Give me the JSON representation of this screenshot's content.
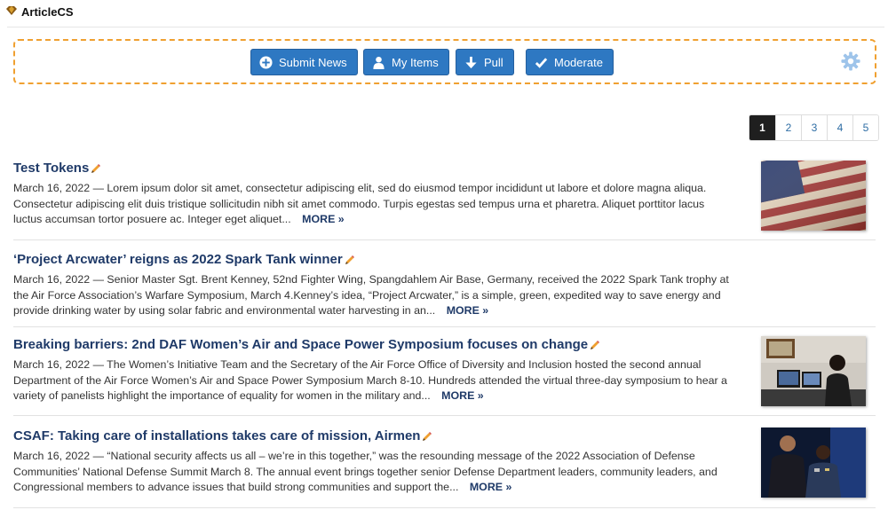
{
  "app": {
    "title": "ArticleCS"
  },
  "toolbar": {
    "submit_label": "Submit News",
    "myitems_label": "My Items",
    "pull_label": "Pull",
    "moderate_label": "Moderate",
    "icons": [
      "plus-circle-icon",
      "user-icon",
      "arrow-down-icon",
      "check-icon",
      "gear-icon"
    ],
    "button_color": "#2e78c2",
    "border_color": "#f0a030"
  },
  "pagination": {
    "pages": [
      "1",
      "2",
      "3",
      "4",
      "5"
    ],
    "active": "1"
  },
  "articles": [
    {
      "title": "Test Tokens",
      "date": "March 16, 2022",
      "summary": "Lorem ipsum dolor sit amet, consectetur adipiscing elit, sed do eiusmod tempor incididunt ut labore et dolore magna aliqua. Consectetur adipiscing elit duis tristique sollicitudin nibh sit amet commodo. Turpis egestas sed tempus urna et pharetra. Aliquet porttitor lacus luctus accumsan tortor posuere ac. Integer eget aliquet...",
      "more": "MORE »",
      "thumbnail": "american-flag-image"
    },
    {
      "title": "‘Project Arcwater’ reigns as 2022 Spark Tank winner",
      "date": "March 16, 2022",
      "summary": "Senior Master Sgt. Brent Kenney, 52nd Fighter Wing, Spangdahlem Air Base, Germany, received the 2022 Spark Tank trophy at the Air Force Association’s Warfare Symposium, March 4.Kenney’s idea, “Project Arcwater,” is a simple, green, expedited way to save energy and provide drinking water by using solar fabric and environmental water harvesting in an...",
      "more": "MORE »"
    },
    {
      "title": "Breaking barriers: 2nd DAF Women’s Air and Space Power Symposium focuses on change",
      "date": "March 16, 2022",
      "summary": "The Women’s Initiative Team and the Secretary of the Air Force Office of Diversity and Inclusion hosted the second annual Department of the Air Force Women’s Air and Space Power Symposium March 8-10.  Hundreds attended the virtual three-day symposium to hear a variety of panelists highlight the importance of equality for women in the military and...",
      "more": "MORE »",
      "thumbnail": "woman-at-computer-image"
    },
    {
      "title": "CSAF: Taking care of installations takes care of mission, Airmen",
      "date": "March 16, 2022",
      "summary": "“National security affects us all – we’re in this together,” was the resounding message of the 2022 Association of Defense Communities’ National Defense Summit March 8. The annual event brings together senior Defense Department leaders, community leaders, and Congressional members to advance issues that build strong communities and support the...",
      "more": "MORE »",
      "thumbnail": "panel-speakers-image"
    }
  ],
  "dash": "—"
}
